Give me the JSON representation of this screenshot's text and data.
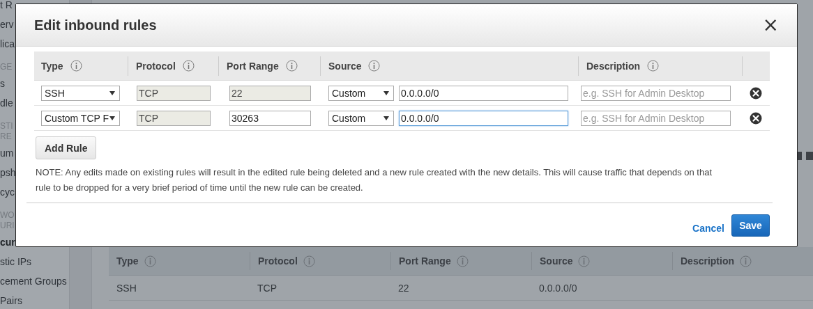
{
  "background": {
    "sidebar": {
      "items": [
        {
          "kind": "link",
          "text": "t R"
        },
        {
          "kind": "link",
          "text": "erv"
        },
        {
          "kind": "link",
          "text": "lica"
        },
        {
          "kind": "heading",
          "lines": [
            "GE"
          ]
        },
        {
          "kind": "link",
          "text": "s"
        },
        {
          "kind": "link",
          "text": "dle"
        },
        {
          "kind": "heading",
          "lines": [
            "STI",
            "RE"
          ]
        },
        {
          "kind": "link",
          "text": "um"
        },
        {
          "kind": "link",
          "text": "psh"
        },
        {
          "kind": "link",
          "text": "cyc"
        },
        {
          "kind": "heading",
          "lines": [
            "WO",
            "URI"
          ]
        },
        {
          "kind": "current",
          "text": "cur"
        },
        {
          "kind": "link",
          "text": "stic IPs"
        },
        {
          "kind": "link",
          "text": "cement Groups"
        },
        {
          "kind": "link",
          "text": "Pairs"
        }
      ]
    },
    "table": {
      "columns": [
        "Type",
        "Protocol",
        "Port Range",
        "Source",
        "Description"
      ],
      "rows": [
        [
          "SSH",
          "TCP",
          "22",
          "0.0.0.0/0",
          ""
        ]
      ]
    }
  },
  "dialog": {
    "title": "Edit inbound rules",
    "close": "×",
    "columns": [
      "Type",
      "Protocol",
      "Port Range",
      "Source",
      "Description"
    ],
    "rules": [
      {
        "type": "SSH",
        "protocol": {
          "value": "TCP",
          "disabled": true
        },
        "port_range": {
          "value": "22",
          "disabled": true
        },
        "source": "Custom",
        "cidr": {
          "value": "0.0.0.0/0",
          "focused": false
        },
        "description": {
          "placeholder": "e.g. SSH for Admin Desktop"
        }
      },
      {
        "type": "Custom TCP F",
        "protocol": {
          "value": "TCP",
          "disabled": true
        },
        "port_range": {
          "value": "30263",
          "disabled": false
        },
        "source": "Custom",
        "cidr": {
          "value": "0.0.0.0/0",
          "focused": true
        },
        "description": {
          "placeholder": "e.g. SSH for Admin Desktop"
        }
      }
    ],
    "add_button": "Add Rule",
    "note": "NOTE: Any edits made on existing rules will result in the edited rule being deleted and a new rule created with the new details. This will cause traffic that depends on that rule to be dropped for a very brief period of time until the new rule can be created.",
    "cancel": "Cancel",
    "save": "Save"
  }
}
